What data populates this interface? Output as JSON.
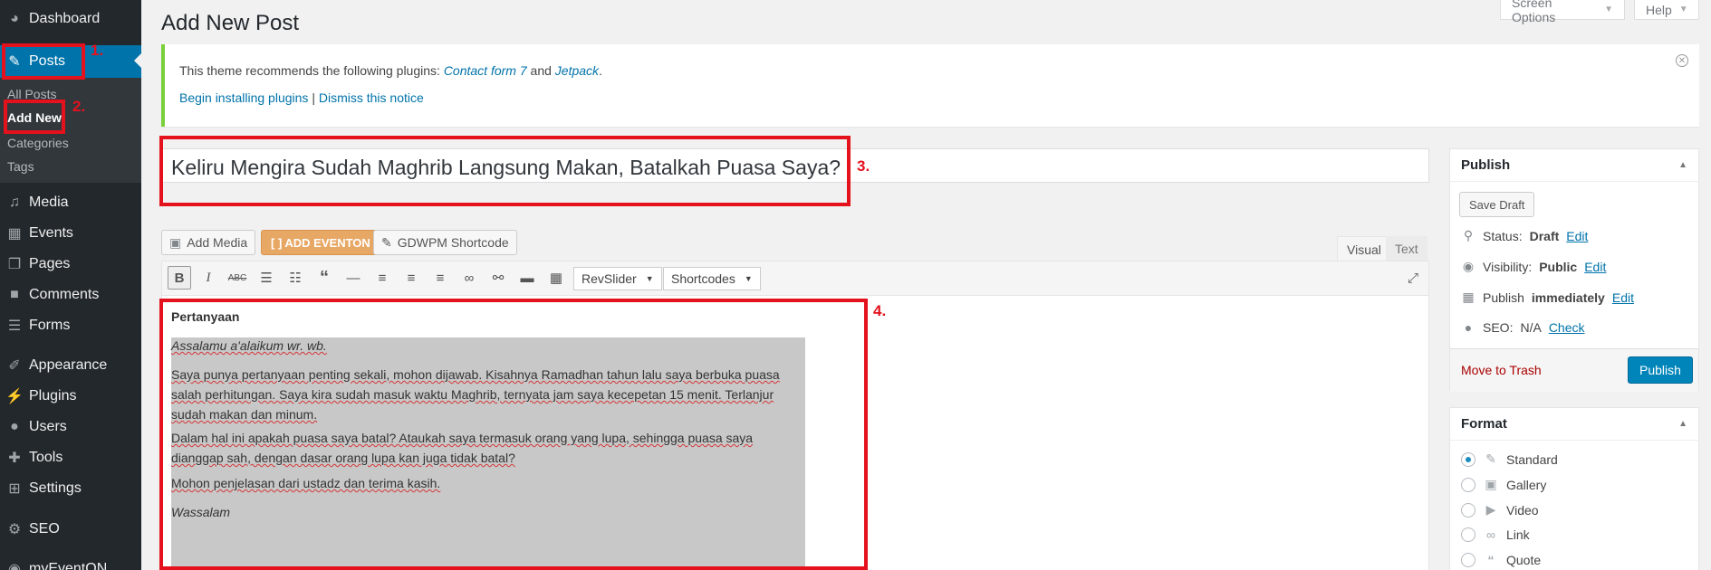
{
  "sidebar": {
    "dashboard": "Dashboard",
    "posts": "Posts",
    "submenu": [
      "All Posts",
      "Add New",
      "Categories",
      "Tags"
    ],
    "media": "Media",
    "events": "Events",
    "pages": "Pages",
    "comments": "Comments",
    "forms": "Forms",
    "appearance": "Appearance",
    "plugins": "Plugins",
    "users": "Users",
    "tools": "Tools",
    "settings": "Settings",
    "seo": "SEO",
    "myeventon": "myEventON"
  },
  "annotations": [
    "1.",
    "2.",
    "3.",
    "4."
  ],
  "header": {
    "title": "Add New Post",
    "screen_options": "Screen Options",
    "help": "Help"
  },
  "notice": {
    "text_before": "This theme recommends the following plugins: ",
    "plugin1": "Contact form 7",
    "and": " and ",
    "plugin2": "Jetpack",
    "period": ".",
    "begin": "Begin installing plugins",
    "sep": " | ",
    "dismiss": "Dismiss this notice"
  },
  "post": {
    "title": "Keliru Mengira Sudah Maghrib Langsung Makan, Batalkah Puasa Saya?"
  },
  "media_buttons": {
    "add_media": "Add Media",
    "add_eventon": "[ ] ADD EVENTON",
    "gdwpm": "GDWPM Shortcode"
  },
  "editor_tabs": {
    "visual": "Visual",
    "text": "Text"
  },
  "toolbar": {
    "revslider": "RevSlider",
    "shortcodes": "Shortcodes"
  },
  "content": {
    "heading": "Pertanyaan",
    "greeting": "Assalamu a'alaikum wr. wb.",
    "p1": "Saya punya pertanyaan penting sekali, mohon dijawab. Kisahnya Ramadhan tahun lalu saya berbuka puasa salah perhitungan. Saya kira sudah masuk waktu Maghrib, ternyata jam saya kecepetan 15 menit. Terlanjur sudah makan dan minum.",
    "p2": "Dalam hal ini apakah puasa saya batal? Ataukah saya termasuk orang yang lupa, sehingga puasa saya dianggap sah, dengan dasar orang lupa kan juga tidak batal?",
    "p3": "Mohon penjelasan dari ustadz dan terima kasih.",
    "closing": "Wassalam"
  },
  "publish_box": {
    "title": "Publish",
    "save_draft": "Save Draft",
    "status_label": "Status:",
    "status_value": "Draft",
    "visibility_label": "Visibility:",
    "visibility_value": "Public",
    "publish_label": "Publish",
    "publish_value": "immediately",
    "seo_label": "SEO:",
    "seo_value": "N/A",
    "edit": "Edit",
    "check": "Check",
    "move_to_trash": "Move to Trash",
    "publish_button": "Publish"
  },
  "format_box": {
    "title": "Format",
    "options": [
      "Standard",
      "Gallery",
      "Video",
      "Link",
      "Quote"
    ],
    "selected": "Standard"
  },
  "colors": {
    "sidebar_bg": "#23282d",
    "active_blue": "#0073aa",
    "annotation_red": "#e3121d",
    "notice_green": "#7ad03a",
    "eventon_orange": "#e8a865",
    "primary_button": "#0085ba"
  }
}
